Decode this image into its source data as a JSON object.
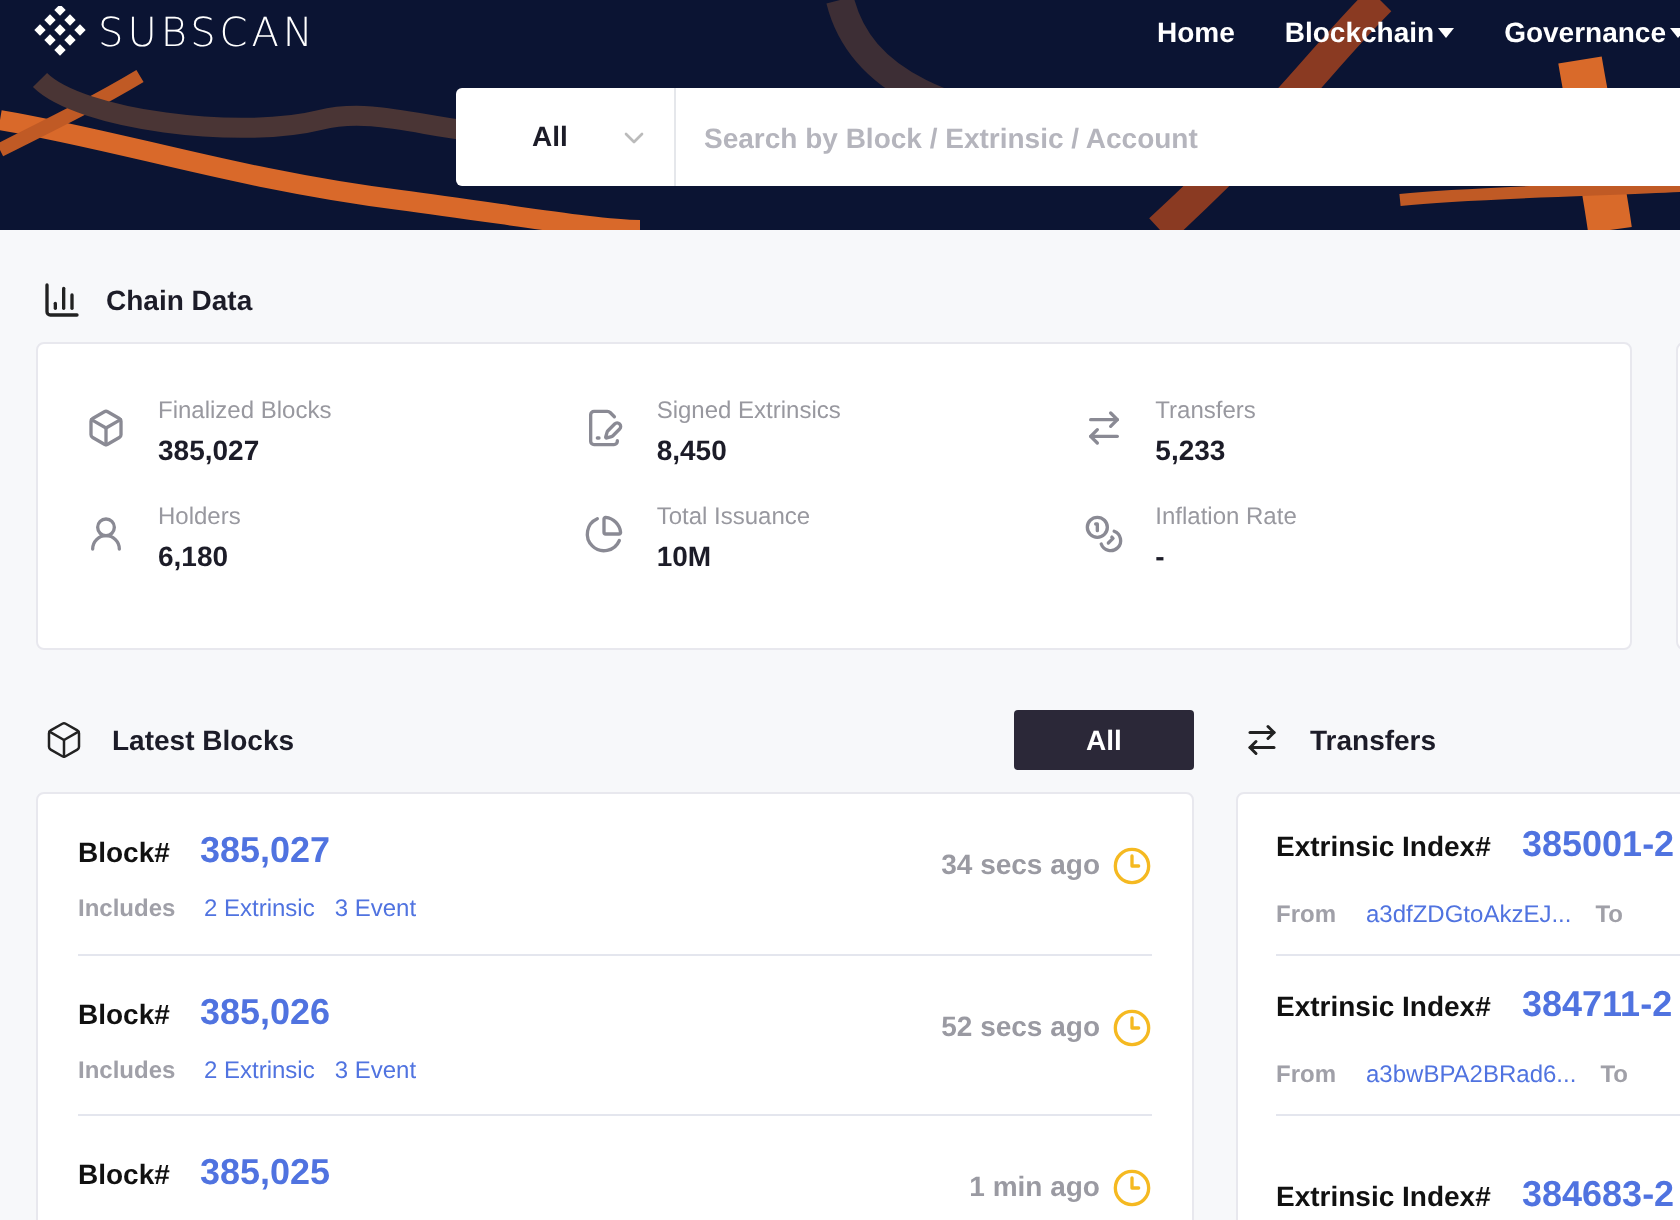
{
  "header": {
    "logo": "SUBSCAN",
    "nav": [
      {
        "label": "Home",
        "dropdown": false
      },
      {
        "label": "Blockchain",
        "dropdown": true
      },
      {
        "label": "Governance",
        "dropdown": true
      }
    ]
  },
  "search": {
    "filter": "All",
    "placeholder": "Search by Block / Extrinsic / Account"
  },
  "chain_data": {
    "title": "Chain Data",
    "stats": [
      {
        "kind": "blocks",
        "label": "Finalized Blocks",
        "value": "385,027"
      },
      {
        "kind": "extrinsics",
        "label": "Signed Extrinsics",
        "value": "8,450"
      },
      {
        "kind": "transfers",
        "label": "Transfers",
        "value": "5,233"
      },
      {
        "kind": "holders",
        "label": "Holders",
        "value": "6,180"
      },
      {
        "kind": "issuance",
        "label": "Total Issuance",
        "value": "10M"
      },
      {
        "kind": "inflation",
        "label": "Inflation Rate",
        "value": "-"
      }
    ]
  },
  "latest_blocks": {
    "title": "Latest Blocks",
    "button": "All",
    "blocks": [
      {
        "label": "Block#",
        "number": "385,027",
        "includes_label": "Includes",
        "extrinsic": "2 Extrinsic",
        "event": "3 Event",
        "time": "34 secs ago"
      },
      {
        "label": "Block#",
        "number": "385,026",
        "includes_label": "Includes",
        "extrinsic": "2 Extrinsic",
        "event": "3 Event",
        "time": "52 secs ago"
      },
      {
        "label": "Block#",
        "number": "385,025",
        "time": "1 min ago"
      }
    ]
  },
  "transfers": {
    "title": "Transfers",
    "items": [
      {
        "label": "Extrinsic Index#",
        "index": "385001-2",
        "from_label": "From",
        "from": "a3dfZDGtoAkzEJ...",
        "to_label": "To"
      },
      {
        "label": "Extrinsic Index#",
        "index": "384711-2",
        "from_label": "From",
        "from": "a3bwBPA2BRad6...",
        "to_label": "To"
      },
      {
        "label": "Extrinsic Index#",
        "index": "384683-2"
      }
    ]
  }
}
